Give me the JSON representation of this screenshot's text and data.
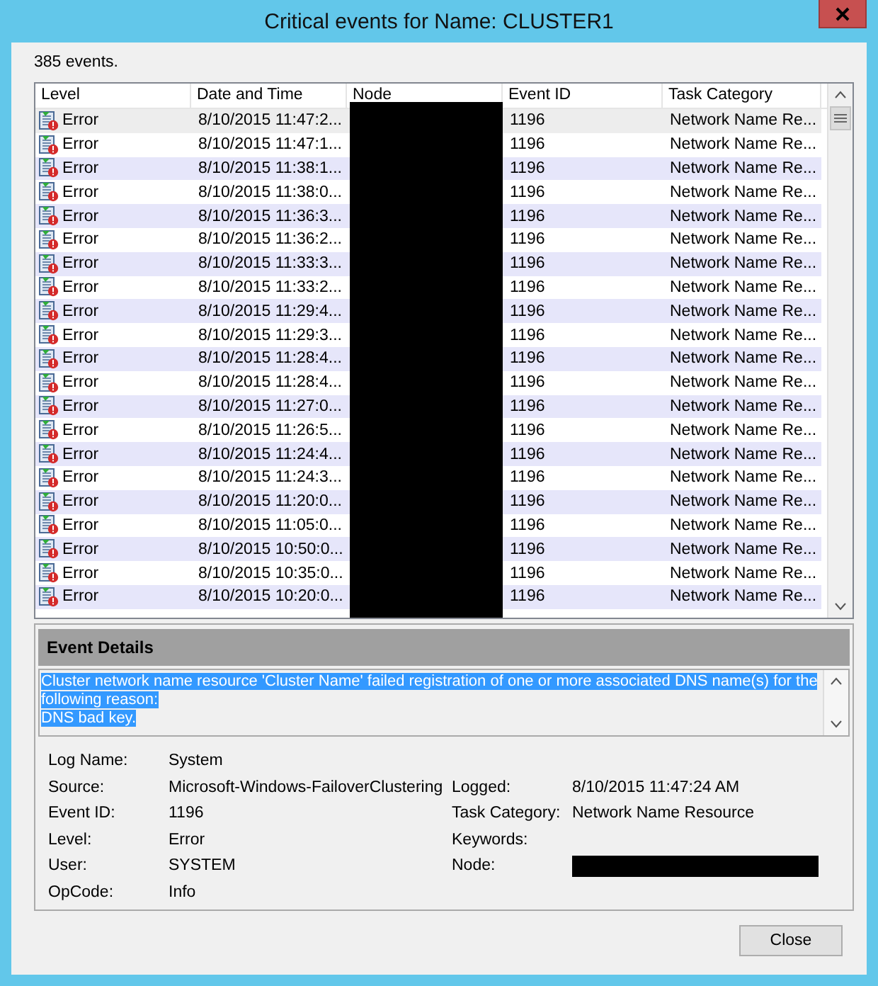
{
  "window": {
    "title": "Critical events for Name: CLUSTER1"
  },
  "event_count": "385 events.",
  "table": {
    "columns": [
      "Level",
      "Date and Time",
      "Node",
      "Event ID",
      "Task Category"
    ],
    "node_redacted": true,
    "rows": [
      {
        "level": "Error",
        "time": "8/10/2015 11:47:2...",
        "event_id": "1196",
        "task_category": "Network Name Re...",
        "selected": true
      },
      {
        "level": "Error",
        "time": "8/10/2015 11:47:1...",
        "event_id": "1196",
        "task_category": "Network Name Re...",
        "selected": false
      },
      {
        "level": "Error",
        "time": "8/10/2015 11:38:1...",
        "event_id": "1196",
        "task_category": "Network Name Re...",
        "selected": false
      },
      {
        "level": "Error",
        "time": "8/10/2015 11:38:0...",
        "event_id": "1196",
        "task_category": "Network Name Re...",
        "selected": false
      },
      {
        "level": "Error",
        "time": "8/10/2015 11:36:3...",
        "event_id": "1196",
        "task_category": "Network Name Re...",
        "selected": false
      },
      {
        "level": "Error",
        "time": "8/10/2015 11:36:2...",
        "event_id": "1196",
        "task_category": "Network Name Re...",
        "selected": false
      },
      {
        "level": "Error",
        "time": "8/10/2015 11:33:3...",
        "event_id": "1196",
        "task_category": "Network Name Re...",
        "selected": false
      },
      {
        "level": "Error",
        "time": "8/10/2015 11:33:2...",
        "event_id": "1196",
        "task_category": "Network Name Re...",
        "selected": false
      },
      {
        "level": "Error",
        "time": "8/10/2015 11:29:4...",
        "event_id": "1196",
        "task_category": "Network Name Re...",
        "selected": false
      },
      {
        "level": "Error",
        "time": "8/10/2015 11:29:3...",
        "event_id": "1196",
        "task_category": "Network Name Re...",
        "selected": false
      },
      {
        "level": "Error",
        "time": "8/10/2015 11:28:4...",
        "event_id": "1196",
        "task_category": "Network Name Re...",
        "selected": false
      },
      {
        "level": "Error",
        "time": "8/10/2015 11:28:4...",
        "event_id": "1196",
        "task_category": "Network Name Re...",
        "selected": false
      },
      {
        "level": "Error",
        "time": "8/10/2015 11:27:0...",
        "event_id": "1196",
        "task_category": "Network Name Re...",
        "selected": false
      },
      {
        "level": "Error",
        "time": "8/10/2015 11:26:5...",
        "event_id": "1196",
        "task_category": "Network Name Re...",
        "selected": false
      },
      {
        "level": "Error",
        "time": "8/10/2015 11:24:4...",
        "event_id": "1196",
        "task_category": "Network Name Re...",
        "selected": false
      },
      {
        "level": "Error",
        "time": "8/10/2015 11:24:3...",
        "event_id": "1196",
        "task_category": "Network Name Re...",
        "selected": false
      },
      {
        "level": "Error",
        "time": "8/10/2015 11:20:0...",
        "event_id": "1196",
        "task_category": "Network Name Re...",
        "selected": false
      },
      {
        "level": "Error",
        "time": "8/10/2015 11:05:0...",
        "event_id": "1196",
        "task_category": "Network Name Re...",
        "selected": false
      },
      {
        "level": "Error",
        "time": "8/10/2015 10:50:0...",
        "event_id": "1196",
        "task_category": "Network Name Re...",
        "selected": false
      },
      {
        "level": "Error",
        "time": "8/10/2015 10:35:0...",
        "event_id": "1196",
        "task_category": "Network Name Re...",
        "selected": false
      },
      {
        "level": "Error",
        "time": "8/10/2015 10:20:0...",
        "event_id": "1196",
        "task_category": "Network Name Re...",
        "selected": false
      }
    ]
  },
  "event_details": {
    "title": "Event Details",
    "description": {
      "lines": [
        "Cluster network name resource 'Cluster Name' failed registration of one or more associated DNS name(s) for the following reason:",
        "DNS bad key."
      ],
      "selected": true
    },
    "fields": [
      {
        "label": "Log Name:",
        "value": "System"
      },
      {
        "label": "Source:",
        "value": "Microsoft-Windows-FailoverClustering"
      },
      {
        "label": "Event ID:",
        "value": "1196"
      },
      {
        "label": "Level:",
        "value": "Error"
      },
      {
        "label": "User:",
        "value": "SYSTEM"
      },
      {
        "label": "OpCode:",
        "value": "Info"
      }
    ],
    "side_fields": [
      {
        "label": "Logged:",
        "value": "8/10/2015 11:47:24 AM"
      },
      {
        "label": "Task Category:",
        "value": "Network Name Resource"
      },
      {
        "label": "Keywords:"
      },
      {
        "label": "Node:",
        "redacted": true
      }
    ]
  },
  "buttons": [
    "Close"
  ]
}
